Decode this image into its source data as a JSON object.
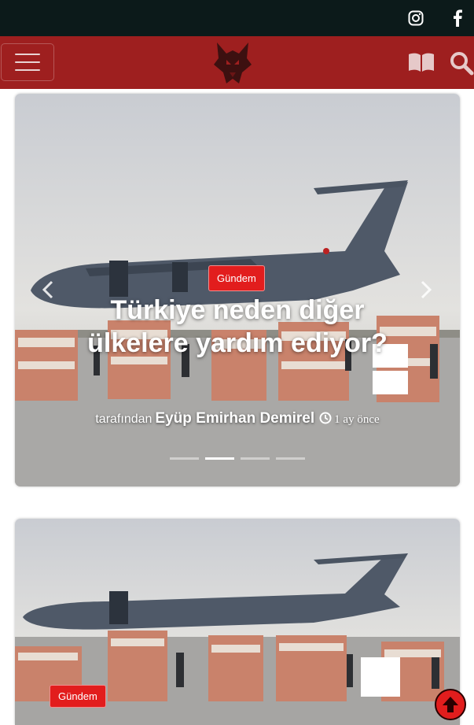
{
  "header": {
    "social": [
      "instagram-icon",
      "facebook-icon"
    ],
    "nav_icons": [
      "menu-icon",
      "wolf-logo",
      "book-icon",
      "search-icon"
    ]
  },
  "colors": {
    "topbar": "#0c1a1a",
    "navbar": "#9e1f1f",
    "badge": "#e21d1d"
  },
  "slider": {
    "category": "Gündem",
    "title": "Türkiye neden diğer ülkelere yardım ediyor?",
    "byline_prefix": "tarafından",
    "author": "Eyüp Emirhan Demirel",
    "time_ago": "1 ay önce",
    "slide_count": 4,
    "active_slide": 2
  },
  "card2": {
    "category": "Gündem"
  }
}
